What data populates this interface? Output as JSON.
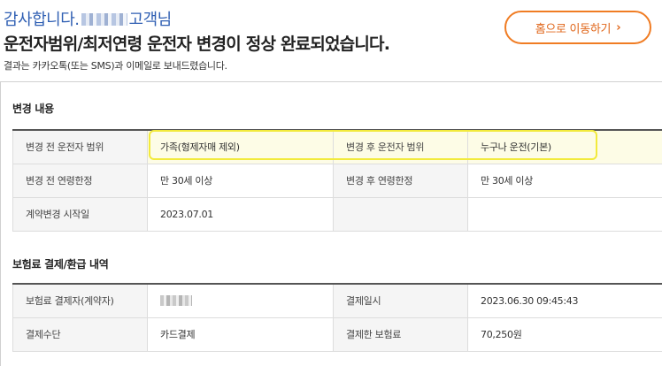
{
  "header": {
    "greeting_prefix": "감사합니다.",
    "greeting_suffix": "고객님",
    "headline": "운전자범위/최저연령 운전자 변경이 정상 완료되었습니다.",
    "subtext": "결과는 카카오톡(또는 SMS)과 이메일로 보내드렸습니다.",
    "home_button": "홈으로 이동하기",
    "home_button_icon": "chevron-right-icon",
    "accent_color": "#2f5fb3",
    "button_color": "#f07c23"
  },
  "change_section": {
    "title": "변경 내용",
    "rows": [
      {
        "before_label": "변경 전 운전자 범위",
        "before_value": "가족(형제자매 제외)",
        "after_label": "변경 후 운전자 범위",
        "after_value": "누구나 운전(기본)"
      },
      {
        "before_label": "변경 전 연령한정",
        "before_value": "만 30세 이상",
        "after_label": "변경 후 연령한정",
        "after_value": "만 30세 이상"
      },
      {
        "before_label": "계약변경 시작일",
        "before_value": "2023.07.01",
        "after_label": "",
        "after_value": ""
      }
    ],
    "highlight_color": "#f2ea3c"
  },
  "payment_section": {
    "title": "보험료 결제/환급 내역",
    "rows": [
      {
        "label_a": "보험료 결제자(계약자)",
        "value_a": "",
        "label_b": "결제일시",
        "value_b": "2023.06.30 09:45:43"
      },
      {
        "label_a": "결제수단",
        "value_a": "카드결제",
        "label_b": "결제한 보험료",
        "value_b": "70,250원"
      }
    ]
  }
}
